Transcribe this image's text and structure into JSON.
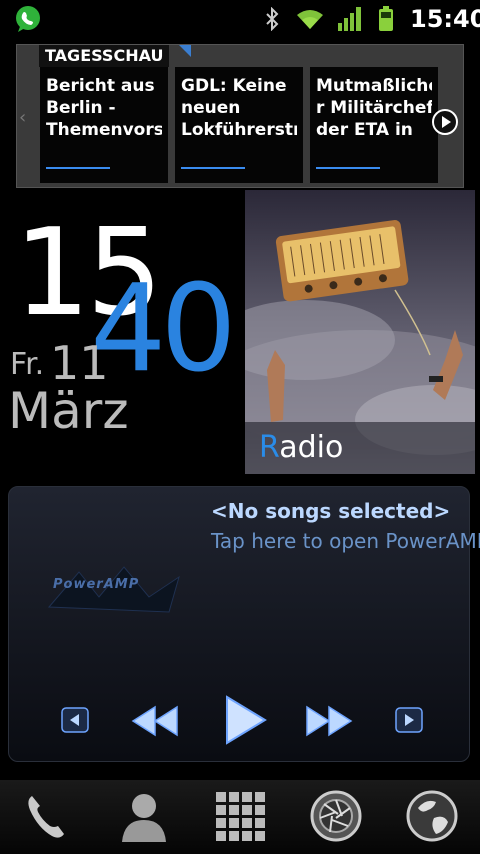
{
  "status_bar": {
    "time": "15:40",
    "icons": [
      "whatsapp-icon",
      "bluetooth-icon",
      "wifi-icon",
      "signal-icon",
      "battery-icon"
    ]
  },
  "news_widget": {
    "header": "TAGESSCHAU",
    "items": [
      {
        "title": "Bericht aus\nBerlin -\nThemenvorsc"
      },
      {
        "title": "GDL: Keine\nneuen\nLokführerstr"
      },
      {
        "title": "Mutmaßliche\nr Militärchef\nder ETA in"
      }
    ]
  },
  "clock_widget": {
    "hour": "15",
    "minute": "40",
    "weekday": "Fr.",
    "day": "11",
    "month": "März"
  },
  "radio_widget": {
    "label_first": "R",
    "label_rest": "adio"
  },
  "poweramp_widget": {
    "title": "<No songs selected>",
    "subtitle": "Tap here to open PowerAMP",
    "logo_text": "PowerAMP",
    "buttons": [
      "prev-album-icon",
      "rewind-icon",
      "play-icon",
      "fast-forward-icon",
      "next-album-icon"
    ]
  },
  "dock": {
    "items": [
      "phone-icon",
      "contacts-icon",
      "app-drawer-icon",
      "camera-aperture-icon",
      "browser-globe-icon"
    ]
  },
  "colors": {
    "accent_blue": "#2a83e0",
    "background": "#000000"
  }
}
